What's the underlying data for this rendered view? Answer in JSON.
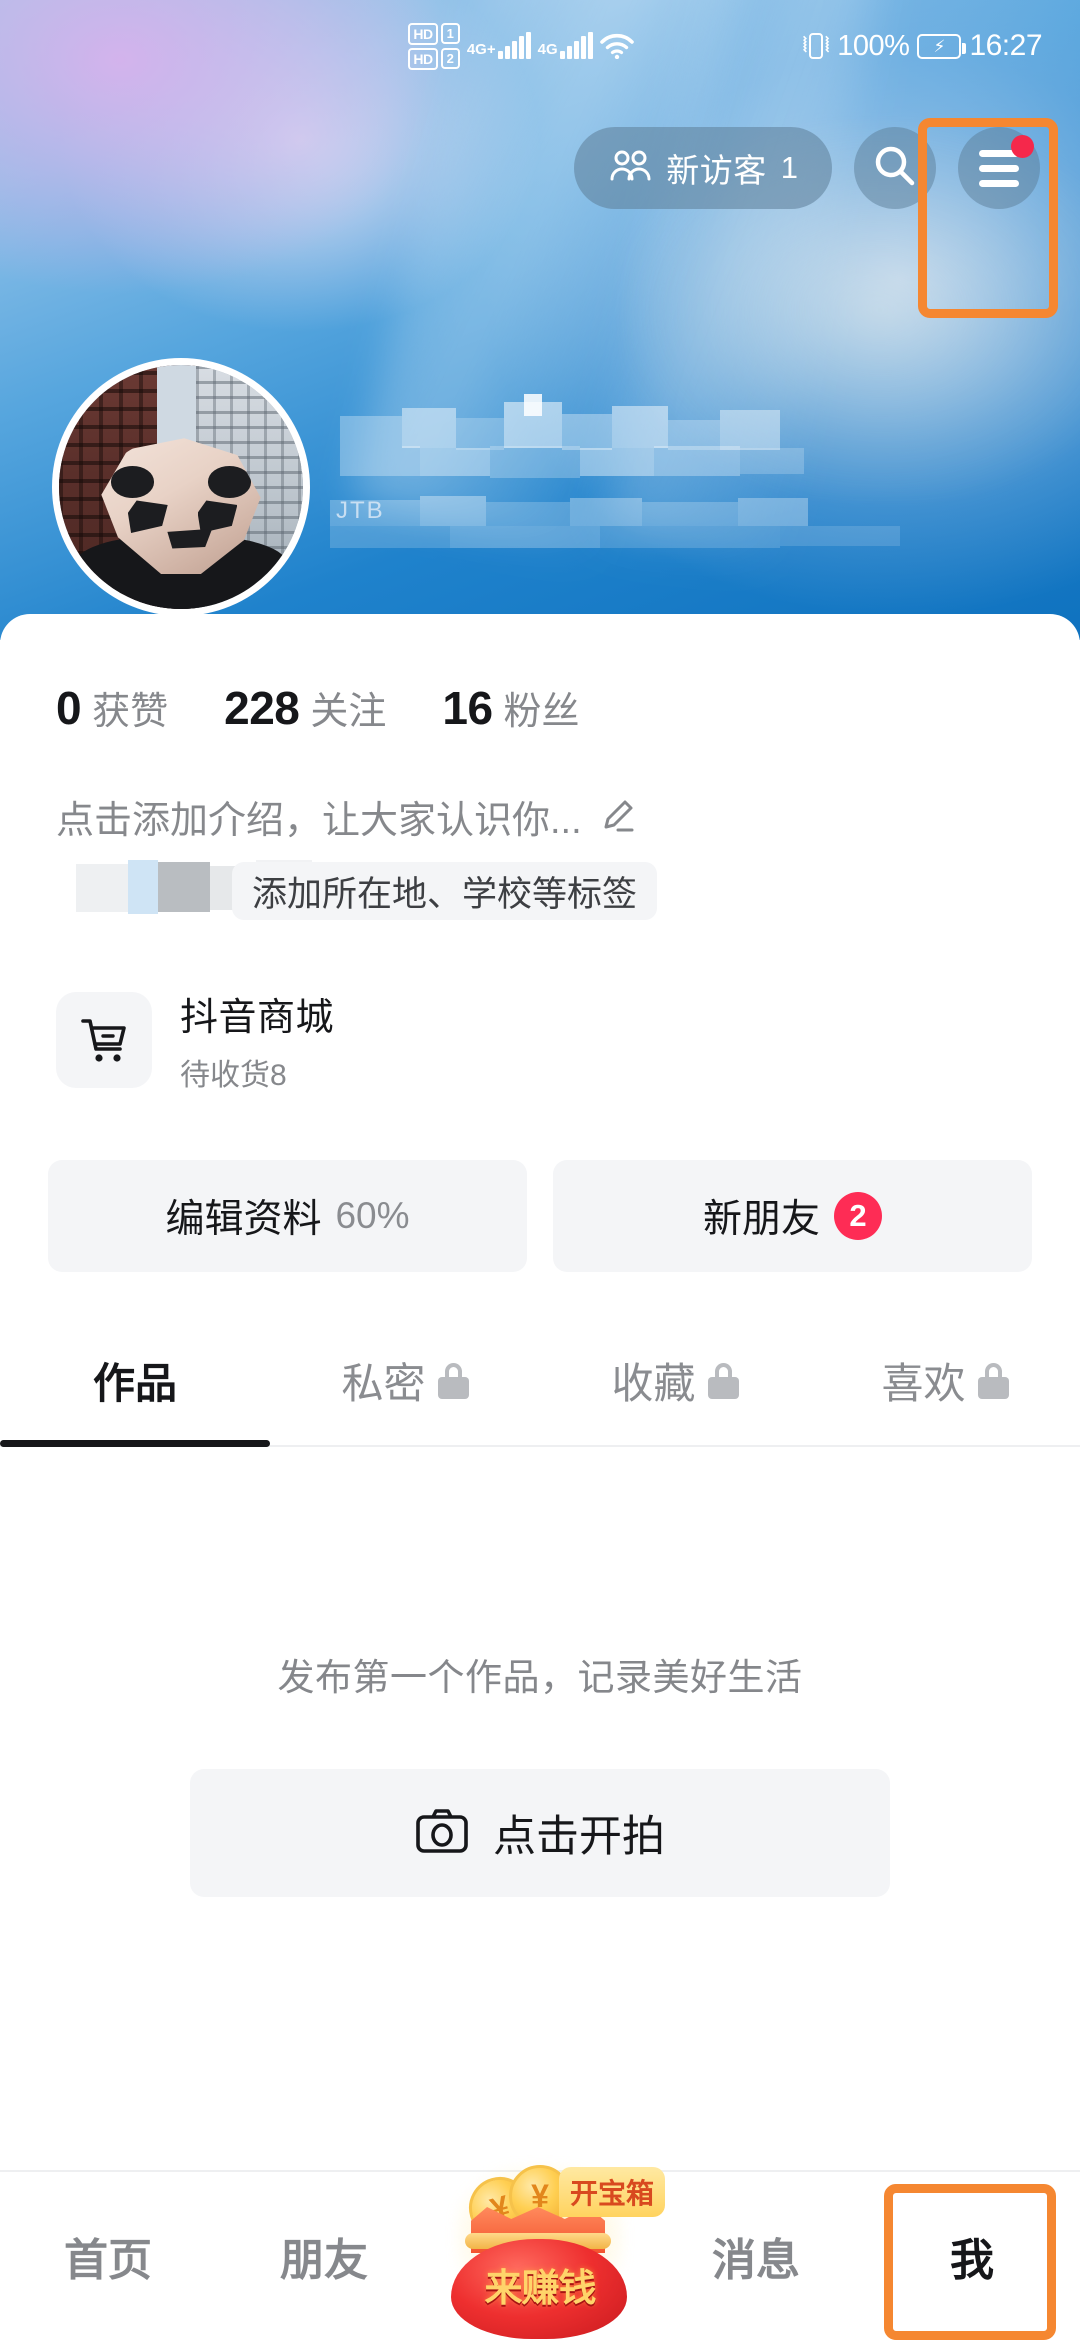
{
  "status_bar": {
    "hd1_label": "HD",
    "hd1_sim": "1",
    "hd2_label": "HD",
    "hd2_sim": "2",
    "network1": "4G+",
    "network2": "4G",
    "wifi_icon": "wifi-icon",
    "vibrate_icon": "vibrate-icon",
    "battery_percent": "100%",
    "battery_icon": "battery-charging-icon",
    "time": "16:27"
  },
  "header": {
    "visitor_pill": {
      "icon": "people-icon",
      "label": "新访客",
      "count": "1"
    },
    "search_icon": "search-icon",
    "menu_icon": "hamburger-menu-icon",
    "menu_has_badge": true
  },
  "profile": {
    "avatar_alt": "低多边形熊猫头像",
    "username_redacted": true,
    "user_id_redacted": true,
    "id_fragment": "JTB",
    "stats": [
      {
        "num": "0",
        "label": "获赞"
      },
      {
        "num": "228",
        "label": "关注"
      },
      {
        "num": "16",
        "label": "粉丝"
      }
    ],
    "bio_placeholder": "点击添加介绍，让大家认识你...",
    "bio_edit_icon": "pencil-icon",
    "tag_placeholder": "添加所在地、学校等标签"
  },
  "shop": {
    "icon": "shopping-cart-icon",
    "title": "抖音商城",
    "subtitle": "待收货8"
  },
  "actions": {
    "edit_profile_label": "编辑资料",
    "edit_profile_percent": "60%",
    "new_friends_label": "新朋友",
    "new_friends_badge": "2"
  },
  "tabs": [
    {
      "label": "作品",
      "locked": false,
      "active": true
    },
    {
      "label": "私密",
      "locked": true,
      "active": false
    },
    {
      "label": "收藏",
      "locked": true,
      "active": false
    },
    {
      "label": "喜欢",
      "locked": true,
      "active": false
    }
  ],
  "empty_state": {
    "message": "发布第一个作品，记录美好生活",
    "button_icon": "camera-icon",
    "button_label": "点击开拍"
  },
  "bottom_nav": [
    {
      "label": "首页",
      "active": false
    },
    {
      "label": "朋友",
      "active": false
    },
    {
      "label": "来赚钱",
      "badge": "开宝箱",
      "active": false,
      "icon": "money-bag-icon"
    },
    {
      "label": "消息",
      "active": false
    },
    {
      "label": "我",
      "active": true
    }
  ],
  "annotations": {
    "color": "#F58731",
    "targets": [
      "hamburger-menu-icon",
      "nav-item-me"
    ]
  }
}
